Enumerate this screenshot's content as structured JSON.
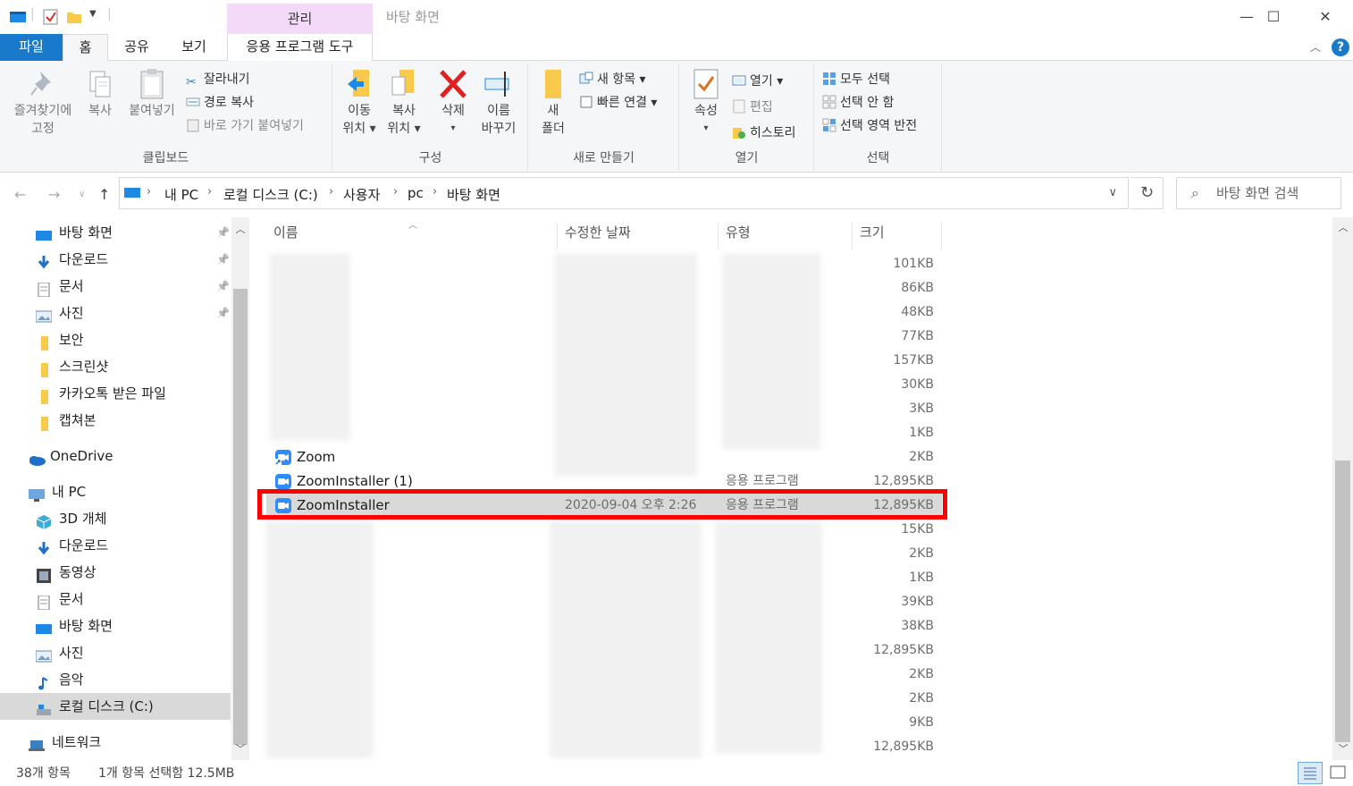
{
  "window": {
    "title": "바탕 화면",
    "contextual_group": "관리",
    "buttons": {
      "minimize": "—",
      "maximize": "☐",
      "close": "✕"
    }
  },
  "tabs": {
    "file": "파일",
    "home": "홈",
    "share": "공유",
    "view": "보기",
    "app_tools": "응용 프로그램 도구"
  },
  "ribbon": {
    "clipboard": {
      "label": "클립보드",
      "pin": [
        "즐겨찾기에",
        "고정"
      ],
      "copy": "복사",
      "paste": "붙여넣기",
      "cut": "잘라내기",
      "copy_path": "경로 복사",
      "paste_shortcut": "바로 가기 붙여넣기"
    },
    "organize": {
      "label": "구성",
      "move_to": [
        "이동",
        "위치 ▾"
      ],
      "copy_to": [
        "복사",
        "위치 ▾"
      ],
      "delete": [
        "삭제",
        "▾"
      ],
      "rename": [
        "이름",
        "바꾸기"
      ]
    },
    "new": {
      "label": "새로 만들기",
      "new_folder": [
        "새",
        "폴더"
      ],
      "new_item": "새 항목 ▾",
      "easy_access": "빠른 연결 ▾"
    },
    "open": {
      "label": "열기",
      "properties": [
        "속성",
        "▾"
      ],
      "open": "열기 ▾",
      "edit": "편집",
      "history": "히스토리"
    },
    "select": {
      "label": "선택",
      "select_all": "모두 선택",
      "select_none": "선택 안 함",
      "invert": "선택 영역 반전"
    }
  },
  "address": {
    "crumbs": [
      "내 PC",
      "로컬 디스크 (C:)",
      "사용자",
      "pc",
      "바탕 화면"
    ],
    "search_placeholder": "바탕 화면 검색"
  },
  "nav": {
    "quick_access": [
      {
        "label": "바탕 화면",
        "icon": "desktop-icon",
        "pinned": true
      },
      {
        "label": "다운로드",
        "icon": "download-icon",
        "pinned": true
      },
      {
        "label": "문서",
        "icon": "document-icon",
        "pinned": true
      },
      {
        "label": "사진",
        "icon": "pictures-icon",
        "pinned": true
      },
      {
        "label": "보안",
        "icon": "folder-icon",
        "pinned": false
      },
      {
        "label": "스크린샷",
        "icon": "folder-icon",
        "pinned": false
      },
      {
        "label": "카카오톡 받은 파일",
        "icon": "folder-icon",
        "pinned": false
      },
      {
        "label": "캡쳐본",
        "icon": "folder-icon",
        "pinned": false
      }
    ],
    "onedrive": "OneDrive",
    "this_pc": "내 PC",
    "pc_items": [
      {
        "label": "3D 개체",
        "icon": "3d-objects-icon"
      },
      {
        "label": "다운로드",
        "icon": "download-icon"
      },
      {
        "label": "동영상",
        "icon": "videos-icon"
      },
      {
        "label": "문서",
        "icon": "document-icon"
      },
      {
        "label": "바탕 화면",
        "icon": "desktop-icon"
      },
      {
        "label": "사진",
        "icon": "pictures-icon"
      },
      {
        "label": "음악",
        "icon": "music-icon"
      },
      {
        "label": "로컬 디스크 (C:)",
        "icon": "drive-icon"
      }
    ],
    "network": "네트워크"
  },
  "columns": {
    "name": "이름",
    "modified": "수정한 날짜",
    "type": "유형",
    "size": "크기"
  },
  "files": [
    {
      "name": "",
      "date": "",
      "type": "",
      "size": "101KB",
      "redacted": true
    },
    {
      "name": "",
      "date": "",
      "type": "",
      "size": "86KB",
      "redacted": true
    },
    {
      "name": "",
      "date": "",
      "type": "",
      "size": "48KB",
      "redacted": true
    },
    {
      "name": "",
      "date": "",
      "type": "",
      "size": "77KB",
      "redacted": true
    },
    {
      "name": "",
      "date": "",
      "type": "",
      "size": "157KB",
      "redacted": true
    },
    {
      "name": "",
      "date": "",
      "type": "",
      "size": "30KB",
      "redacted": true
    },
    {
      "name": "",
      "date": "",
      "type": "",
      "size": "3KB",
      "redacted": true
    },
    {
      "name": "",
      "date": "",
      "type": "",
      "size": "1KB",
      "redacted": true
    },
    {
      "name": "Zoom",
      "date": "",
      "type": "",
      "size": "2KB",
      "redacted": false,
      "icon": "zoom-shortcut-icon"
    },
    {
      "name": "ZoomInstaller (1)",
      "date": "",
      "type": "응용 프로그램",
      "size": "12,895KB",
      "redacted": false,
      "icon": "zoom-app-icon"
    },
    {
      "name": "ZoomInstaller",
      "date": "2020-09-04 오후 2:26",
      "type": "응용 프로그램",
      "size": "12,895KB",
      "redacted": false,
      "selected": true,
      "icon": "zoom-app-icon"
    },
    {
      "name": "",
      "date": "",
      "type": "",
      "size": "15KB",
      "redacted": true
    },
    {
      "name": "",
      "date": "",
      "type": "",
      "size": "2KB",
      "redacted": true
    },
    {
      "name": "",
      "date": "",
      "type": "",
      "size": "1KB",
      "redacted": true
    },
    {
      "name": "",
      "date": "",
      "type": "",
      "size": "39KB",
      "redacted": true
    },
    {
      "name": "",
      "date": "",
      "type": "",
      "size": "38KB",
      "redacted": true
    },
    {
      "name": "",
      "date": "",
      "type": "",
      "size": "12,895KB",
      "redacted": true
    },
    {
      "name": "",
      "date": "",
      "type": "",
      "size": "2KB",
      "redacted": true
    },
    {
      "name": "",
      "date": "",
      "type": "",
      "size": "2KB",
      "redacted": true
    },
    {
      "name": "",
      "date": "",
      "type": "",
      "size": "9KB",
      "redacted": true
    },
    {
      "name": "",
      "date": "",
      "type": "",
      "size": "12,895KB",
      "redacted": true
    }
  ],
  "status": {
    "count": "38개 항목",
    "selection": "1개 항목 선택함 12.5MB"
  },
  "colors": {
    "accent": "#1979ca",
    "manage_tab": "#f4daf9",
    "selection": "#d9d9d9",
    "highlight": "#ff0000"
  }
}
